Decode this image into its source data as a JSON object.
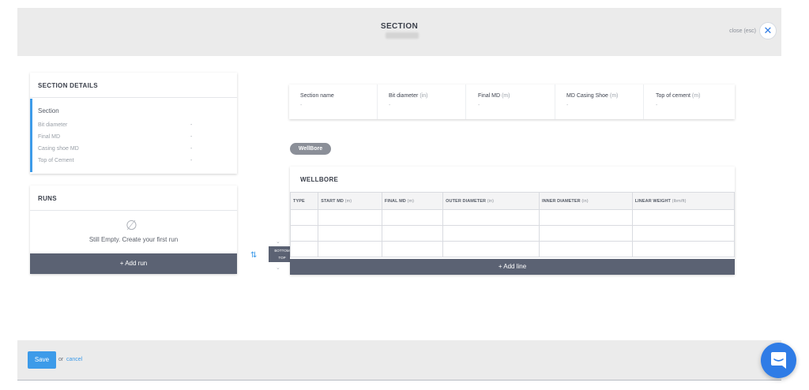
{
  "header": {
    "title": "SECTION",
    "close_text": "close (esc)",
    "close_icon": "close-icon"
  },
  "details": {
    "title": "SECTION DETAILS",
    "section_name": "Section",
    "rows": [
      {
        "label": "Bit diameter",
        "value": "-"
      },
      {
        "label": "Final MD",
        "value": "-"
      },
      {
        "label": "Casing shoe MD",
        "value": "-"
      },
      {
        "label": "Top of Cement",
        "value": "-"
      }
    ]
  },
  "runs": {
    "title": "RUNS",
    "empty_icon": "empty-set-icon",
    "empty_text": "Still Empty. Create your first run",
    "add_label": "+ Add run"
  },
  "summary": [
    {
      "label": "Section name",
      "unit": "",
      "value": "-"
    },
    {
      "label": "Bit diameter",
      "unit": "(in)",
      "value": "-"
    },
    {
      "label": "Final MD",
      "unit": "(m)",
      "value": "-"
    },
    {
      "label": "MD Casing Shoe",
      "unit": "(m)",
      "value": "-"
    },
    {
      "label": "Top of cement",
      "unit": "(m)",
      "value": "-"
    }
  ],
  "orientation": {
    "bottom": "BOTTOM",
    "top": "TOP"
  },
  "wellbore": {
    "badge": "WellBore",
    "title": "WELLBORE",
    "columns": [
      {
        "label": "TYPE",
        "unit": ""
      },
      {
        "label": "START MD",
        "unit": "(m)"
      },
      {
        "label": "FINAL MD",
        "unit": "(m)"
      },
      {
        "label": "OUTER DIAMETER",
        "unit": "(in)"
      },
      {
        "label": "INNER DIAMETER",
        "unit": "(in)"
      },
      {
        "label": "LINEAR WEIGHT",
        "unit": "(lbm/ft)"
      }
    ],
    "add_label": "+ Add line"
  },
  "footer": {
    "save_label": "Save",
    "or_text": "or",
    "cancel_label": "cancel"
  },
  "colors": {
    "accent": "#3d9be9",
    "dark_button": "#5b6273",
    "chat": "#2f7ce6"
  }
}
